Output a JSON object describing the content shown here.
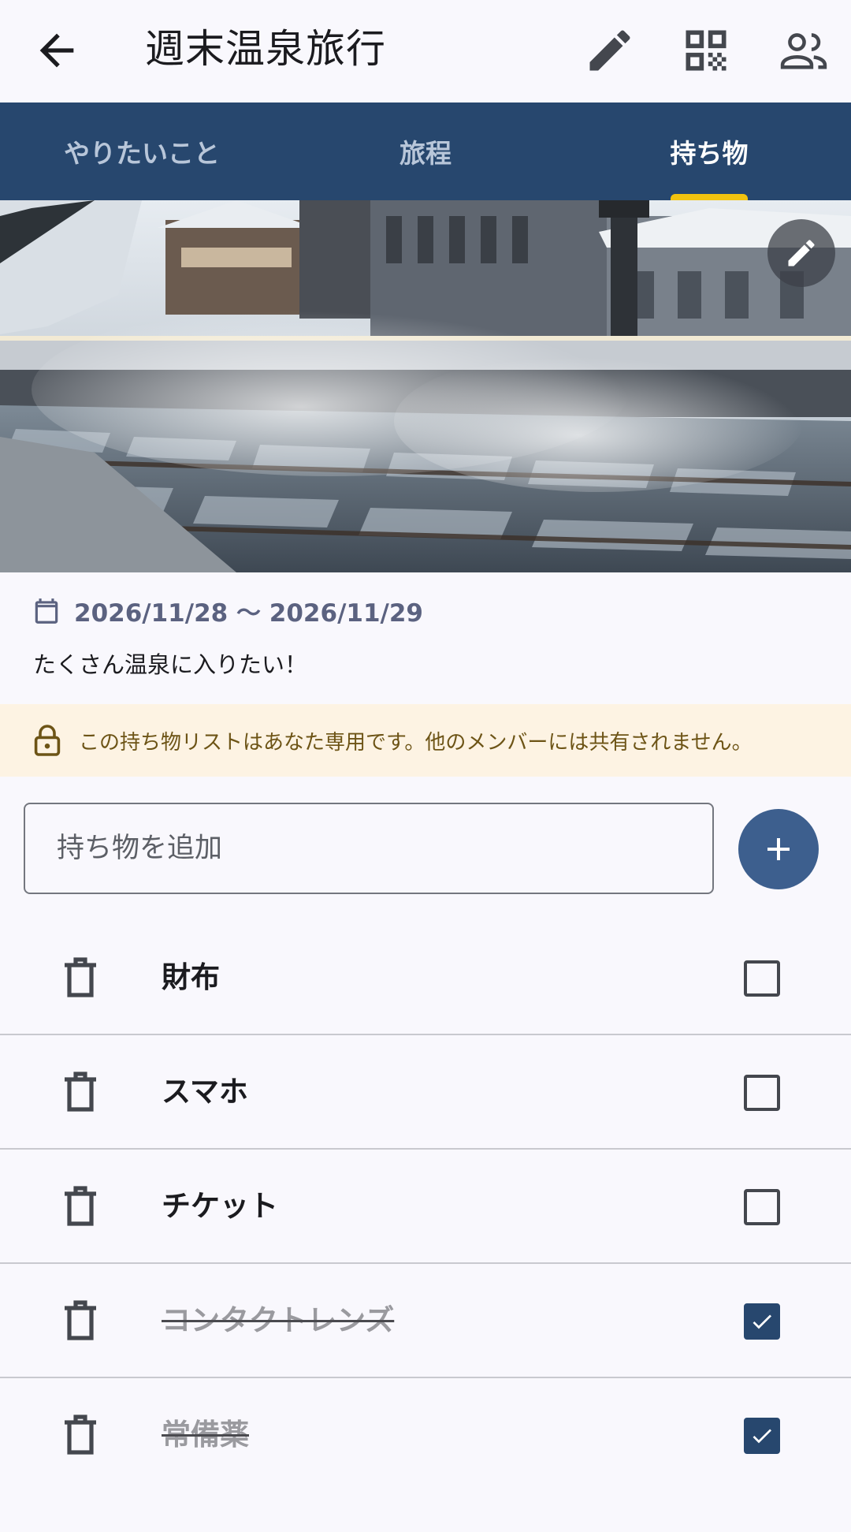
{
  "appbar": {
    "title": "週末温泉旅行",
    "back_icon": "arrow-back-icon",
    "actions": [
      "edit-icon",
      "qr-code-icon",
      "people-icon"
    ]
  },
  "tabs": [
    {
      "label": "やりたいこと",
      "active": false
    },
    {
      "label": "旅程",
      "active": false
    },
    {
      "label": "持ち物",
      "active": true
    }
  ],
  "colors": {
    "primary": "#27476e",
    "tab_indicator": "#f2c30f",
    "fab": "#3d5f8e",
    "notice_bg": "#fdf3e3",
    "notice_text": "#6d5416"
  },
  "trip": {
    "dates": "2026/11/28 〜 2026/11/29",
    "memo": "たくさん温泉に入りたい！"
  },
  "notice": {
    "text": "この持ち物リストはあなた専用です。他のメンバーには共有されません。",
    "icon": "lock-icon"
  },
  "add": {
    "placeholder": "持ち物を追加",
    "value": ""
  },
  "items": [
    {
      "label": "財布",
      "checked": false
    },
    {
      "label": "スマホ",
      "checked": false
    },
    {
      "label": "チケット",
      "checked": false
    },
    {
      "label": "コンタクトレンズ",
      "checked": true
    },
    {
      "label": "常備薬",
      "checked": true
    }
  ]
}
